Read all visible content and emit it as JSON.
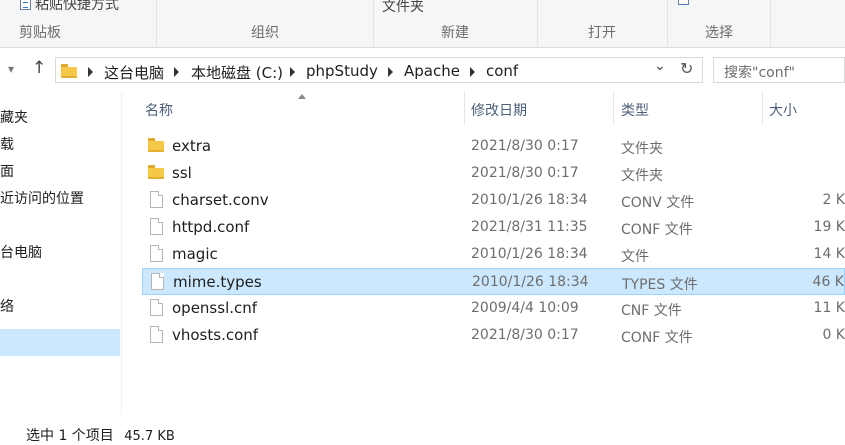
{
  "ribbon": {
    "clipboard": {
      "label": "剪贴板",
      "cmd_paste_shortcut": "粘贴快捷方式"
    },
    "organize": {
      "label": "组织"
    },
    "new": {
      "label": "新建",
      "cmd_new_folder": "文件夹"
    },
    "open": {
      "label": "打开"
    },
    "select": {
      "label": "选择"
    }
  },
  "address_bar": {
    "crumbs": [
      "这台电脑",
      "本地磁盘 (C:)",
      "phpStudy",
      "Apache",
      "conf"
    ],
    "search_placeholder": "搜索\"conf\""
  },
  "nav_pane": {
    "items": [
      {
        "label": "藏夹"
      },
      {
        "label": "载"
      },
      {
        "label": "面"
      },
      {
        "label": "近访问的位置"
      },
      {
        "label": "台电脑",
        "selected": true
      },
      {
        "label": "络"
      }
    ]
  },
  "columns": {
    "name": "名称",
    "date": "修改日期",
    "type": "类型",
    "size": "大小"
  },
  "files": [
    {
      "name": "extra",
      "date": "2021/8/30 0:17",
      "type": "文件夹",
      "size": "",
      "icon": "folder-icon"
    },
    {
      "name": "ssl",
      "date": "2021/8/30 0:17",
      "type": "文件夹",
      "size": "",
      "icon": "folder-icon"
    },
    {
      "name": "charset.conv",
      "date": "2010/1/26 18:34",
      "type": "CONV 文件",
      "size": "2 K",
      "icon": "file-icon"
    },
    {
      "name": "httpd.conf",
      "date": "2021/8/31 11:35",
      "type": "CONF 文件",
      "size": "19 K",
      "icon": "file-icon"
    },
    {
      "name": "magic",
      "date": "2010/1/26 18:34",
      "type": "文件",
      "size": "14 K",
      "icon": "file-icon"
    },
    {
      "name": "mime.types",
      "date": "2010/1/26 18:34",
      "type": "TYPES 文件",
      "size": "46 K",
      "icon": "file-icon",
      "selected": true
    },
    {
      "name": "openssl.cnf",
      "date": "2009/4/4 10:09",
      "type": "CNF 文件",
      "size": "11 K",
      "icon": "file-icon"
    },
    {
      "name": "vhosts.conf",
      "date": "2021/8/30 0:17",
      "type": "CONF 文件",
      "size": "0 K",
      "icon": "file-icon"
    }
  ],
  "status": {
    "selection": "选中 1 个项目",
    "size": "45.7 KB"
  },
  "colors": {
    "selection_bg": "#cce8ff",
    "selection_border": "#99d1ff",
    "header_text": "#4c607a"
  }
}
